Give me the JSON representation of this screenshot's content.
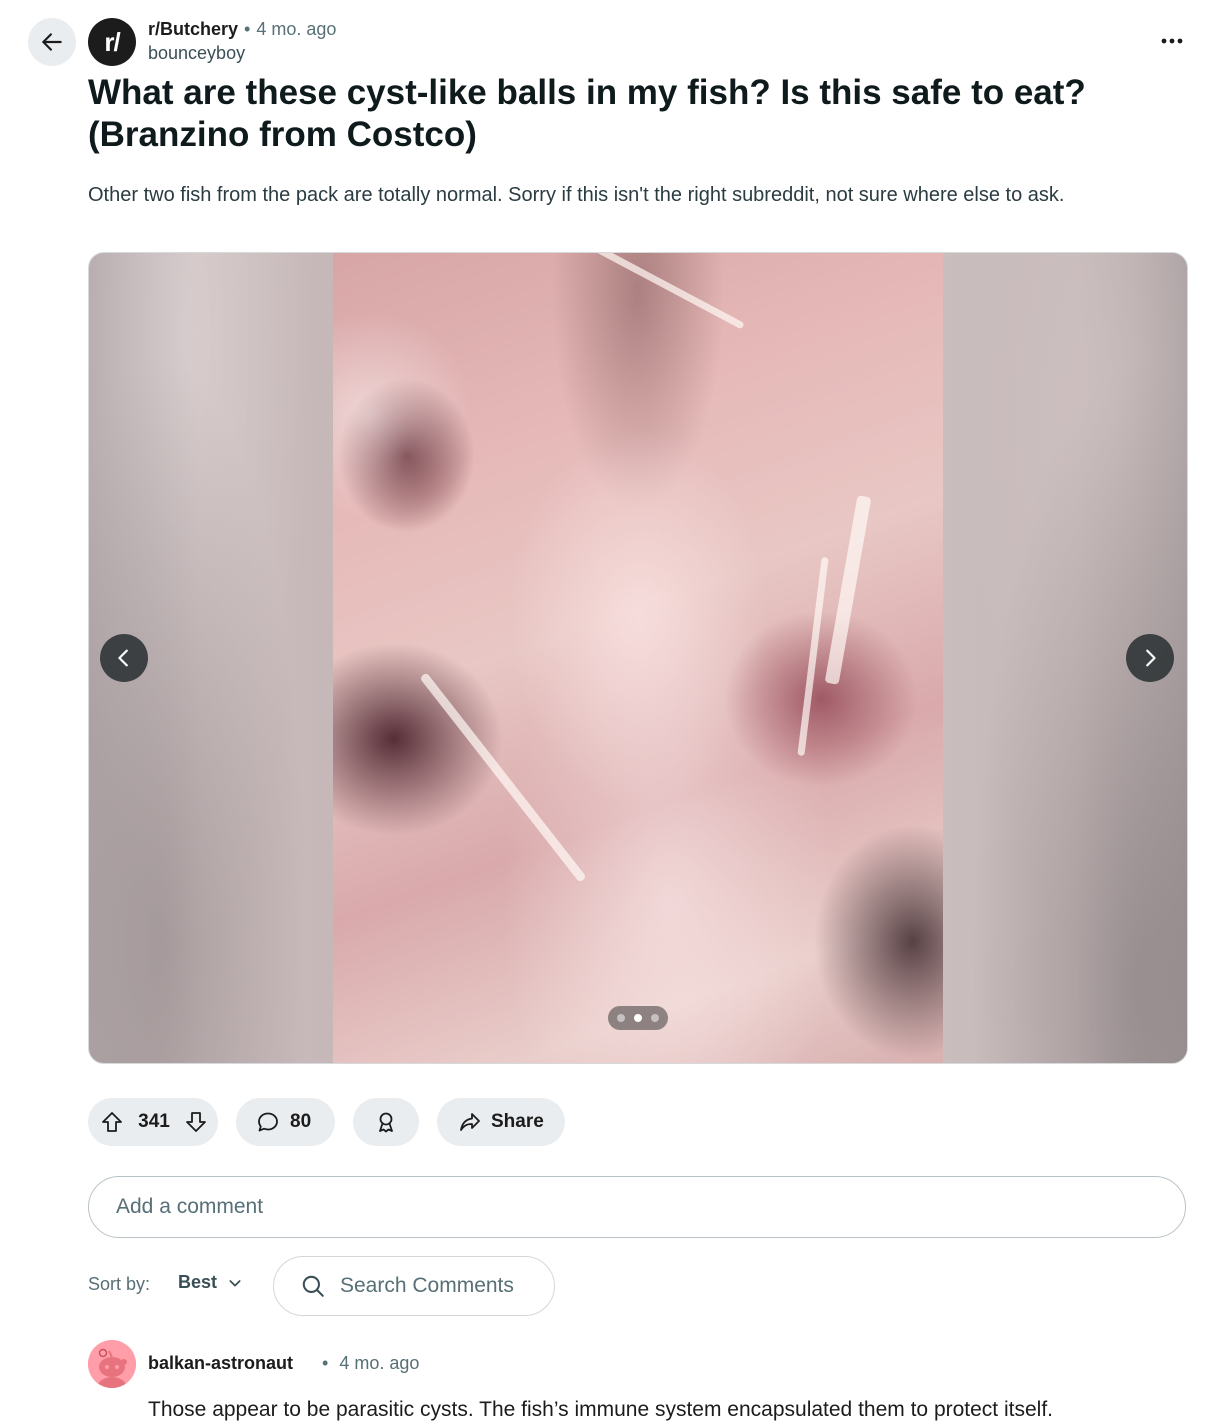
{
  "post": {
    "subreddit": "r/Butchery",
    "separator": "•",
    "time": "4 mo. ago",
    "author": "bounceyboy",
    "avatar_text": "r/",
    "title": "What are these cyst-like balls in my fish? Is this safe to eat? (Branzino from Costco)",
    "body": "Other two fish from the pack are totally normal. Sorry if this isn't the right subreddit, not sure where else to ask."
  },
  "gallery": {
    "pages": 3,
    "current_page": 2
  },
  "actions": {
    "votes": "341",
    "comments": "80",
    "share_label": "Share"
  },
  "comment_input": {
    "placeholder": "Add a comment"
  },
  "sort": {
    "label": "Sort by:",
    "value": "Best"
  },
  "search": {
    "placeholder": "Search Comments"
  },
  "comments": [
    {
      "author": "balkan-astronaut",
      "separator": "•",
      "time": "4 mo. ago",
      "body": "Those appear to be parasitic cysts. The fish’s immune system encapsulated them to protect itself."
    }
  ]
}
